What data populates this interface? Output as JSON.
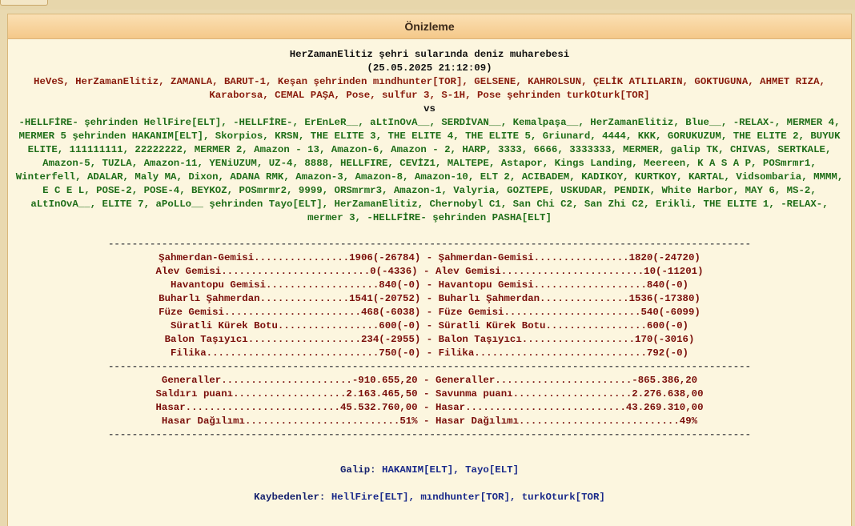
{
  "panel": {
    "title": "Önizleme"
  },
  "battle": {
    "title": "HerZamanElitiz şehri sularında deniz muharebesi",
    "datetime": "(25.05.2025 21:12:09)",
    "team_a": "HeVeS, HerZamanElitiz, ZAMANLA, BARUT-1, Keşan şehrinden mındhunter[TOR], GELSENE, KAHROLSUN, ÇELİK ATLILARIN, GOKTUGUNA, AHMET RIZA, Karaborsa, CEMAL PAŞA, Pose, sulfur 3, S-1H, Pose şehrinden turkOturk[TOR]",
    "vs": "vs",
    "team_b": "-HELLFİRE- şehrinden HellFire[ELT], -HELLFİRE-, ErEnLeR__, aLtInOvA__, SERDİVAN__, Kemalpaşa__, HerZamanElitiz, Blue__, -RELAX-, MERMER 4, MERMER 5 şehrinden HAKANIM[ELT], Skorpios, KRSN, THE ELITE 3, THE ELITE 4, THE ELITE 5, Griunard, 4444, KKK, GORUKUZUM, THE ELITE 2, BUYUK ELITE, 111111111, 22222222, MERMER 2, Amazon - 13, Amazon-6, Amazon - 2, HARP, 3333, 6666, 3333333, MERMER, galip TK, CHIVAS, SERTKALE, Amazon-5, TUZLA, Amazon-11, YENiUZUM, UZ-4, 8888, HELLFIRE, CEVİZ1, MALTEPE, Astapor, Kings Landing, Meereen, K A S A P, POSmrmr1, Winterfell, ADALAR, Maly MA, Dixon, ADANA RMK, Amazon-3, Amazon-8, Amazon-10, ELT 2, ACIBADEM, KADIKOY, KURTKOY, KARTAL, Vidsombaria, MMMM, E C E L, POSE-2, POSE-4, BEYKOZ, POSmrmr2, 9999, ORSmrmr3, Amazon-1, Valyria, GOZTEPE, USKUDAR, PENDIK, White Harbor, MAY 6, MS-2, aLtInOvA__, ELITE 7, aPoLLo__ şehrinden Tayo[ELT], HerZamanElitiz, Chernobyl C1, San Chi C2, San Zhi C2, Erikli, THE ELITE 1, -RELAX-, mermer 3, -HELLFİRE- şehrinden PASHA[ELT]"
  },
  "table": {
    "rule": "------------------------------------------------------------------------------------------------------------",
    "ships": [
      {
        "left": "Şahmerdan-Gemisi................1906(-26784)",
        "right": "Şahmerdan-Gemisi................1820(-24720)"
      },
      {
        "left": "Alev Gemisi.........................0(-4336)",
        "right": "Alev Gemisi........................10(-11201)"
      },
      {
        "left": "Havantopu Gemisi...................840(-0)",
        "right": "Havantopu Gemisi...................840(-0)"
      },
      {
        "left": "Buharlı Şahmerdan...............1541(-20752)",
        "right": "Buharlı Şahmerdan...............1536(-17380)"
      },
      {
        "left": "Füze Gemisi.......................468(-6038)",
        "right": "Füze Gemisi.......................540(-6099)"
      },
      {
        "left": "Süratli Kürek Botu.................600(-0)",
        "right": "Süratli Kürek Botu.................600(-0)"
      },
      {
        "left": "Balon Taşıyıcı...................234(-2955)",
        "right": "Balon Taşıyıcı...................170(-3016)"
      },
      {
        "left": "Filika.............................750(-0)",
        "right": "Filika.............................792(-0)"
      }
    ],
    "stats": [
      {
        "left": "Generaller......................-910.655,20",
        "right": "Generaller.......................-865.386,20"
      },
      {
        "left": "Saldırı puanı...................2.163.465,50",
        "right": "Savunma puanı....................2.276.638,00"
      },
      {
        "left": "Hasar..........................45.532.760,00",
        "right": "Hasar...........................43.269.310,00"
      },
      {
        "left": "Hasar Dağılımı..........................51%",
        "right": "Hasar Dağılımı...........................49%"
      }
    ],
    "sep": " - "
  },
  "results": {
    "winner_label": "Galip:",
    "winners": "HAKANIM[ELT], Tayo[ELT]",
    "loser_label": "Kaybedenler:",
    "losers": "HellFire[ELT], mındhunter[TOR], turkOturk[TOR]"
  }
}
